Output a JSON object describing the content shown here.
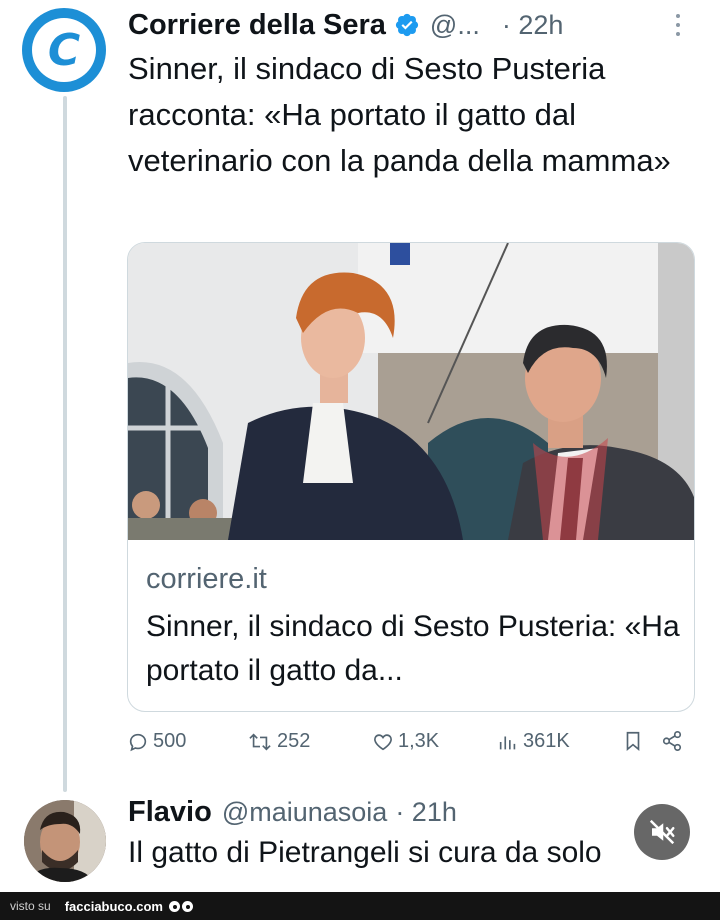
{
  "tweet": {
    "author_name": "Corriere della Sera",
    "author_handle": "@...",
    "time": "· 22h",
    "avatar_letter": "C",
    "text": "Sinner, il sindaco di Sesto Pusteria racconta: «Ha portato il gatto dal veterinario con la panda della mamma»",
    "card": {
      "domain": "corriere.it",
      "title": "Sinner, il sindaco di Sesto Pusteria: «Ha portato il gatto da..."
    },
    "actions": {
      "replies": "500",
      "retweets": "252",
      "likes": "1,3K",
      "views": "361K"
    }
  },
  "reply": {
    "author_name": "Flavio",
    "author_handle": "@maiunasoia",
    "time": "· 21h",
    "text": "Il gatto di Pietrangeli si cura da solo"
  },
  "footer": {
    "visto_label": "visto su",
    "site": "facciabuco.com"
  },
  "colors": {
    "accent": "#1d9bf0",
    "text": "#0f1419",
    "muted": "#536471",
    "border": "#cfd9de"
  }
}
